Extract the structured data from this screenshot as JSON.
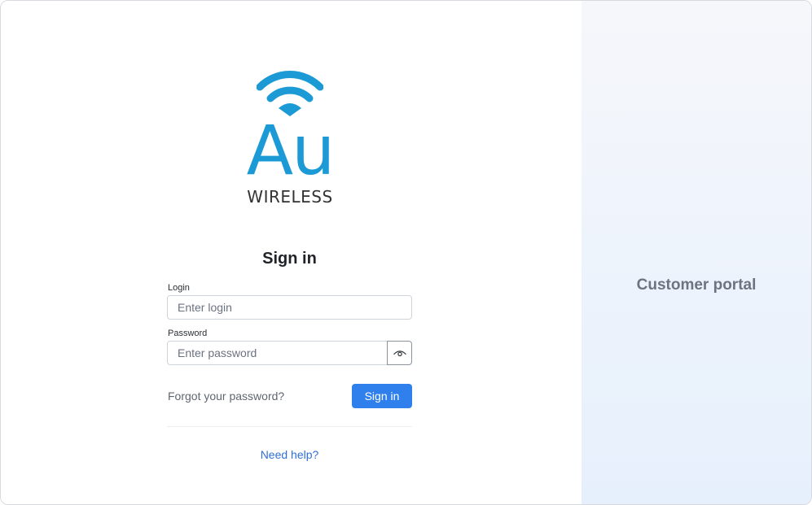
{
  "logo": {
    "brand": "Au",
    "tagline": "WIRELESS",
    "icon": "wifi-icon",
    "color": "#1b9ad6"
  },
  "signin": {
    "title": "Sign in",
    "login_label": "Login",
    "login_placeholder": "Enter login",
    "login_value": "",
    "password_label": "Password",
    "password_placeholder": "Enter password",
    "password_value": "",
    "show_password_icon": "eye-icon",
    "forgot_label": "Forgot your password?",
    "submit_label": "Sign in",
    "help_label": "Need help?"
  },
  "side_panel": {
    "label": "Customer portal"
  },
  "colors": {
    "accent": "#2f80ed",
    "link": "#2f6fd6"
  }
}
